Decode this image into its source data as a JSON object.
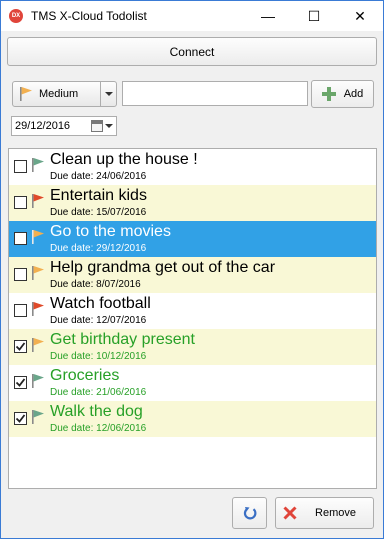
{
  "window": {
    "title": "TMS X-Cloud Todolist",
    "app_icon_text": "DX",
    "minimize_glyph": "—",
    "maximize_glyph": "☐",
    "close_glyph": "✕"
  },
  "toolbar": {
    "connect_label": "Connect",
    "priority_selected": "Medium",
    "add_label": "Add",
    "new_task_value": "",
    "date_value": "29/12/2016"
  },
  "colors": {
    "row_alt": "#f9f8d6",
    "row_selected": "#31a1e6",
    "done_text": "#27a027",
    "flag_high": "#e04a2a",
    "flag_medium": "#f2b050",
    "flag_low": "#6aa68a"
  },
  "tasks": [
    {
      "title": "Clean up the house !",
      "due": "Due date: 24/06/2016",
      "done": false,
      "priority": "low",
      "selected": false
    },
    {
      "title": "Entertain kids",
      "due": "Due date: 15/07/2016",
      "done": false,
      "priority": "high",
      "selected": false
    },
    {
      "title": "Go to the movies",
      "due": "Due date: 29/12/2016",
      "done": false,
      "priority": "medium",
      "selected": true
    },
    {
      "title": "Help grandma get out of the car",
      "due": "Due date: 8/07/2016",
      "done": false,
      "priority": "medium",
      "selected": false
    },
    {
      "title": "Watch football",
      "due": "Due date: 12/07/2016",
      "done": false,
      "priority": "high",
      "selected": false
    },
    {
      "title": "Get birthday present",
      "due": "Due date: 10/12/2016",
      "done": true,
      "priority": "medium",
      "selected": false
    },
    {
      "title": "Groceries",
      "due": "Due date: 21/06/2016",
      "done": true,
      "priority": "low",
      "selected": false
    },
    {
      "title": "Walk the dog",
      "due": "Due date: 12/06/2016",
      "done": true,
      "priority": "low",
      "selected": false
    }
  ],
  "footer": {
    "refresh_icon": "refresh-icon",
    "remove_label": "Remove"
  }
}
